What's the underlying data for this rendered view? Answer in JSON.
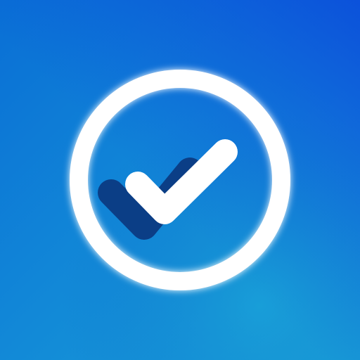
{
  "icon": {
    "name": "checkmark-circle-icon",
    "colors": {
      "gradient_top_left": "#0a6fd6",
      "gradient_top_right": "#0a3fdc",
      "gradient_bottom_right": "#1aa3d8",
      "gradient_bottom_left": "#0b5ec8",
      "ring": "#ffffff",
      "check": "#ffffff",
      "check_shadow": "#0b3e86"
    }
  }
}
